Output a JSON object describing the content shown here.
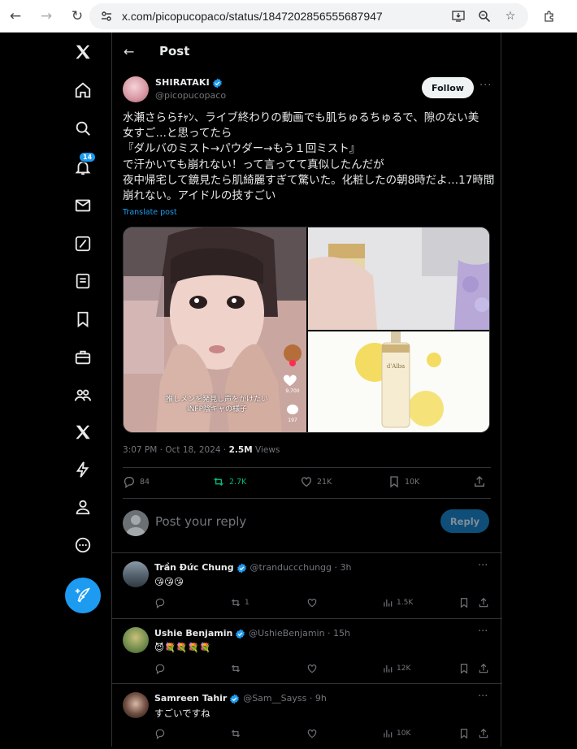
{
  "browser": {
    "url": "x.com/picopucopaco/status/1847202856555687947",
    "back_icon": "arrow-left-icon",
    "forward_icon": "arrow-right-icon",
    "reload_icon": "reload-icon"
  },
  "sidebar": {
    "notifications_count": "14",
    "items": [
      "x-logo",
      "home",
      "explore",
      "notifications",
      "messages",
      "grok",
      "lists",
      "bookmarks",
      "jobs",
      "communities",
      "premium",
      "verified-orgs",
      "profile",
      "more"
    ]
  },
  "header": {
    "title": "Post"
  },
  "post": {
    "author_name": "SHIRATAKI",
    "author_handle": "@picopucopaco",
    "follow_label": "Follow",
    "text_lines": [
      "水瀬さららﾁｬﾝ、ライブ終わりの動画でも肌ちゅるちゅるで、隙のない美",
      "女すご…と思ってたら",
      "『ダルバのミスト→パウダー→もう１回ミスト』",
      "で汗かいても崩れない！って言ってて真似したんだが",
      "夜中帰宅して鏡見たら肌綺麗すぎて驚いた。化粧したの朝8時だよ…17時間",
      "崩れない。アイドルの技すごい"
    ],
    "translate_label": "Translate post",
    "media_caption_line1": "推しメンを発見し声をかけたい",
    "media_caption_line2": "INFP陰キャの様子",
    "video_likes": "9,700",
    "video_comments": "197",
    "product_label": "d'Alba",
    "time": "3:07 PM · Oct 18, 2024 · ",
    "views": "2.5M",
    "views_label": " Views",
    "stats": {
      "replies": "84",
      "reposts": "2.7K",
      "likes": "21K",
      "bookmarks": "10K"
    }
  },
  "reply_box": {
    "placeholder": "Post your reply",
    "button": "Reply"
  },
  "replies": [
    {
      "name": "Trần Đức Chung",
      "handle": "@tranduccchungg · 3h",
      "text": "😘😘😘",
      "reposts": "1",
      "views": "1.5K"
    },
    {
      "name": "Ushie Benjamin",
      "handle": "@UshieBenjamin · 15h",
      "text": "😈💐💐💐💐",
      "reposts": "",
      "views": "12K"
    },
    {
      "name": "Samreen Tahir",
      "handle": "@Sam__Sayss · 9h",
      "text": "すごいですね",
      "reposts": "",
      "views": "10K"
    }
  ],
  "colors": {
    "accent": "#1d9bf0",
    "repost_active": "#00ba7c",
    "background": "#000000"
  }
}
